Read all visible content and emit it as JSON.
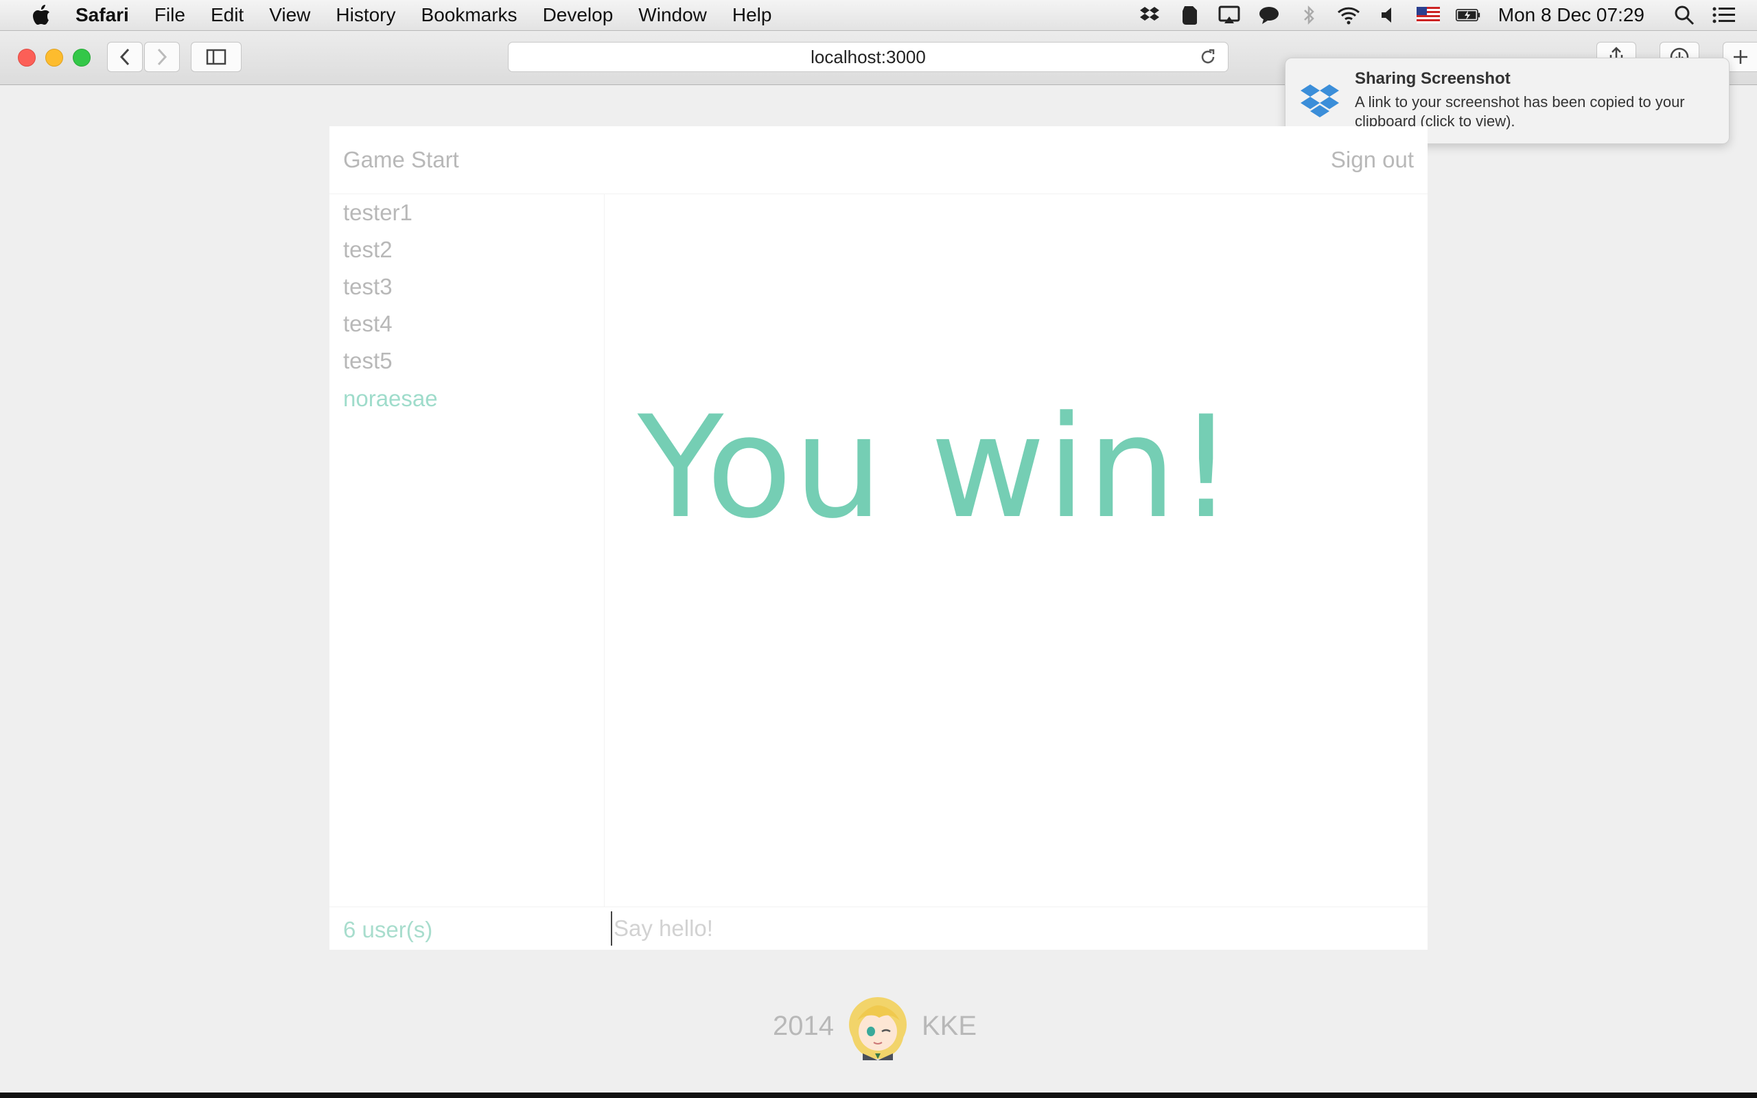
{
  "menubar": {
    "app_name": "Safari",
    "items": [
      "File",
      "Edit",
      "View",
      "History",
      "Bookmarks",
      "Develop",
      "Window",
      "Help"
    ],
    "clock": "Mon 8 Dec  07:29"
  },
  "browser": {
    "url": "localhost:3000"
  },
  "notification": {
    "title": "Sharing Screenshot",
    "body": "A link to your screenshot has been copied to your clipboard (click to view)."
  },
  "app": {
    "game_start": "Game Start",
    "sign_out": "Sign out",
    "users": [
      "tester1",
      "test2",
      "test3",
      "test4",
      "test5",
      "noraesae"
    ],
    "current_user": "noraesae",
    "result": "You win!",
    "user_count": "6 user(s)",
    "chat_placeholder": "Say hello!"
  },
  "footer": {
    "year": "2014",
    "author": "KKE"
  },
  "colors": {
    "accent": "#5ec6a8",
    "muted": "#b8b8b8",
    "background": "#efefef"
  }
}
